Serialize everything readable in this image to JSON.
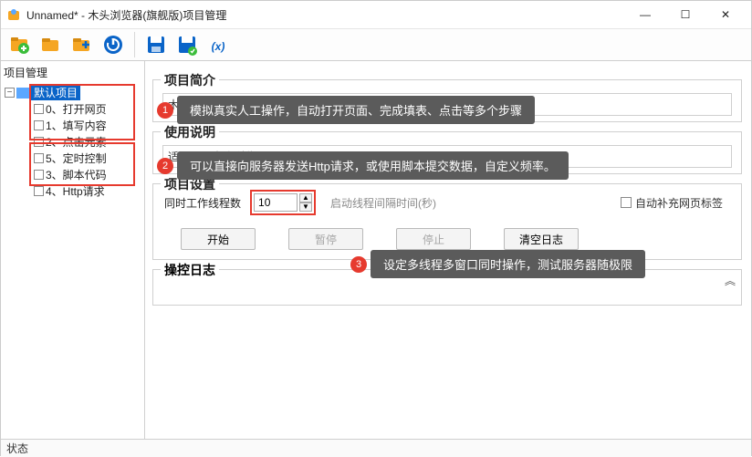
{
  "title": "Unnamed* - 木头浏览器(旗舰版)项目管理",
  "sidebar": {
    "label": "项目管理",
    "root": "默认项目",
    "items": [
      {
        "label": "0、打开网页"
      },
      {
        "label": "1、填写内容"
      },
      {
        "label": "2、点击元素"
      },
      {
        "label": "5、定时控制"
      },
      {
        "label": "3、脚本代码"
      },
      {
        "label": "4、Http请求"
      }
    ]
  },
  "sections": {
    "intro": {
      "title": "项目简介",
      "line": "木头软件出品"
    },
    "usage": {
      "title": "使用说明",
      "line": "适用于《木头浏览器》Ver.8.1.5.0"
    },
    "settings": {
      "title": "项目设置",
      "threads_label": "同时工作线程数",
      "threads_value": "10",
      "interval_label": "启动线程间隔时间(秒)",
      "auto_tab": "自动补充网页标签"
    },
    "log": {
      "title": "操控日志"
    }
  },
  "buttons": {
    "start": "开始",
    "pause": "暂停",
    "stop": "停止",
    "clear": "清空日志"
  },
  "annotations": {
    "a1": "模拟真实人工操作，自动打开页面、完成填表、点击等多个步骤",
    "a2": "可以直接向服务器发送Http请求，或使用脚本提交数据，自定义频率。",
    "a3": "设定多线程多窗口同时操作，测试服务器随极限"
  },
  "statusbar": "状态",
  "win": {
    "min": "—",
    "max": "☐",
    "close": "✕"
  }
}
